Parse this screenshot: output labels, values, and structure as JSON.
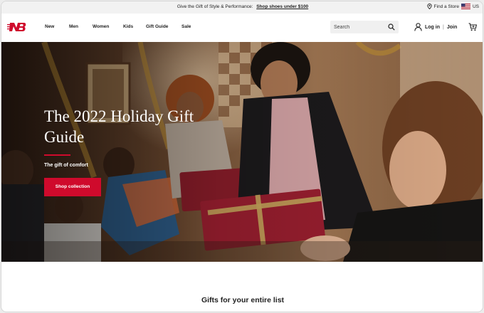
{
  "promo": {
    "text": "Give the Gift of Style & Performance:",
    "link": "Shop shoes under $100",
    "find_store": "Find a Store",
    "region": "US"
  },
  "nav": {
    "items": [
      "New",
      "Men",
      "Women",
      "Kids",
      "Gift Guide",
      "Sale"
    ],
    "search_placeholder": "Search",
    "login": "Log in",
    "join": "Join",
    "separator": "|"
  },
  "hero": {
    "title": "The 2022 Holiday Gift Guide",
    "subtitle": "The gift of comfort",
    "cta": "Shop collection"
  },
  "section": {
    "title": "Gifts for your entire list"
  },
  "colors": {
    "brand_red": "#cf0a2c",
    "promo_bg": "#f2f2f2",
    "search_bg": "#f0f0f0"
  },
  "icons": [
    "new-balance-logo",
    "location-pin-icon",
    "us-flag-icon",
    "search-icon",
    "user-icon",
    "cart-icon"
  ]
}
